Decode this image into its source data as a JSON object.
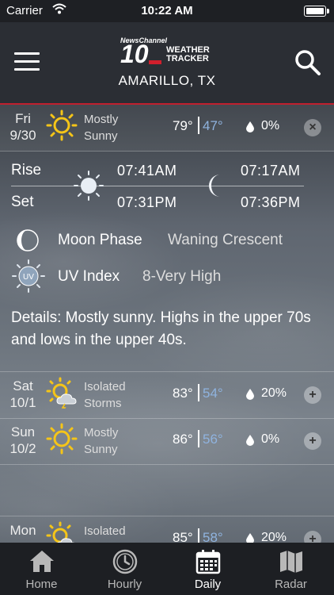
{
  "status_bar": {
    "carrier": "Carrier",
    "time": "10:22 AM"
  },
  "header": {
    "logo_brand": "NewsChannel",
    "logo_number": "10",
    "logo_line1": "WEATHER",
    "logo_line2": "TRACKER",
    "city": "AMARILLO, TX"
  },
  "forecast": [
    {
      "day": "Fri",
      "date": "9/30",
      "condition_line1": "Mostly",
      "condition_line2": "Sunny",
      "high": "79°",
      "low": "47°",
      "precip": "0%",
      "icon": "sun-icon",
      "action": "×"
    },
    {
      "day": "Sat",
      "date": "10/1",
      "condition_line1": "Isolated",
      "condition_line2": "Storms",
      "high": "83°",
      "low": "54°",
      "precip": "20%",
      "icon": "sun-storm-icon",
      "action": "+"
    },
    {
      "day": "Sun",
      "date": "10/2",
      "condition_line1": "Mostly",
      "condition_line2": "Sunny",
      "high": "86°",
      "low": "56°",
      "precip": "0%",
      "icon": "sun-icon",
      "action": "+"
    },
    {
      "day": "Mon",
      "date": "",
      "condition_line1": "Isolated",
      "condition_line2": "",
      "high": "85°",
      "low": "58°",
      "precip": "20%",
      "icon": "sun-storm-icon",
      "action": "+"
    }
  ],
  "details": {
    "rise_label": "Rise",
    "set_label": "Set",
    "sunrise": "07:41AM",
    "sunset": "07:31PM",
    "moonrise": "07:17AM",
    "moonset": "07:36PM",
    "moon_phase_label": "Moon Phase",
    "moon_phase_value": "Waning Crescent",
    "uv_label": "UV Index",
    "uv_value": "8-Very High",
    "uv_icon_text": "UV",
    "text": "Details: Mostly sunny. Highs in the upper 70s and lows in the upper 40s."
  },
  "tabs": [
    {
      "label": "Home",
      "icon": "home-icon"
    },
    {
      "label": "Hourly",
      "icon": "clock-icon"
    },
    {
      "label": "Daily",
      "icon": "calendar-icon"
    },
    {
      "label": "Radar",
      "icon": "map-icon"
    }
  ],
  "active_tab": "Daily",
  "colors": {
    "accent_red": "#c0202e",
    "low_temp": "#8fb3df",
    "sun_yellow": "#f5c518"
  }
}
